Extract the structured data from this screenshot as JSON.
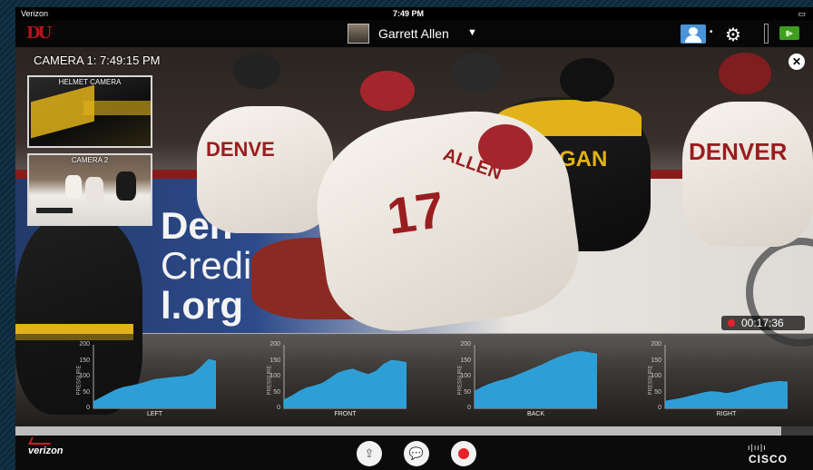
{
  "status_bar": {
    "carrier": "Verizon",
    "time": "7:49 PM"
  },
  "nav": {
    "logo_text": "DU",
    "user_name": "Garrett Allen",
    "gear_icon": "gear-icon",
    "profile_icon": "user-profile-icon"
  },
  "video": {
    "camera_label": "CAMERA 1: 7:49:15 PM",
    "ad_text_line1": "Den",
    "ad_text_line2": "Credit",
    "ad_text_line3": "l.org",
    "jersey_center_name": "ALLEN",
    "jersey_center_number": "17",
    "jersey_left_text": "DENVE",
    "jersey_mich_text": "HIGAN",
    "jersey_right_text": "DENVER",
    "close_icon": "close-icon"
  },
  "thumbnails": [
    {
      "label": "HELMET CAMERA"
    },
    {
      "label": "CAMERA 2"
    }
  ],
  "recording": {
    "elapsed": "00:17:36",
    "status_color": "#e6222a"
  },
  "sensors": {
    "axis_title": "PRESSURE",
    "ticks": [
      "200",
      "150",
      "100",
      "50",
      "0"
    ],
    "ylim": [
      0,
      200
    ],
    "fill_color": "#2e9fd6",
    "items": [
      {
        "label": "LEFT",
        "values": [
          22,
          35,
          48,
          60,
          68,
          72,
          78,
          85,
          92,
          95,
          98,
          100,
          102,
          110,
          130,
          155,
          150
        ]
      },
      {
        "label": "FRONT",
        "values": [
          28,
          40,
          55,
          66,
          72,
          80,
          95,
          112,
          120,
          125,
          115,
          108,
          118,
          140,
          152,
          150,
          145
        ]
      },
      {
        "label": "BACK",
        "values": [
          55,
          68,
          78,
          86,
          92,
          100,
          110,
          120,
          130,
          140,
          152,
          162,
          170,
          178,
          180,
          176,
          172
        ]
      },
      {
        "label": "RIGHT",
        "values": [
          24,
          28,
          32,
          38,
          44,
          50,
          54,
          52,
          48,
          52,
          60,
          68,
          74,
          80,
          84,
          86,
          84
        ]
      }
    ]
  },
  "playback": {
    "progress": 0.96
  },
  "toolbar": {
    "brand_left": "verizon",
    "brand_right": "CISCO",
    "share_icon": "share-icon",
    "chat_icon": "chat-bubble-icon",
    "record_icon": "record-icon"
  }
}
